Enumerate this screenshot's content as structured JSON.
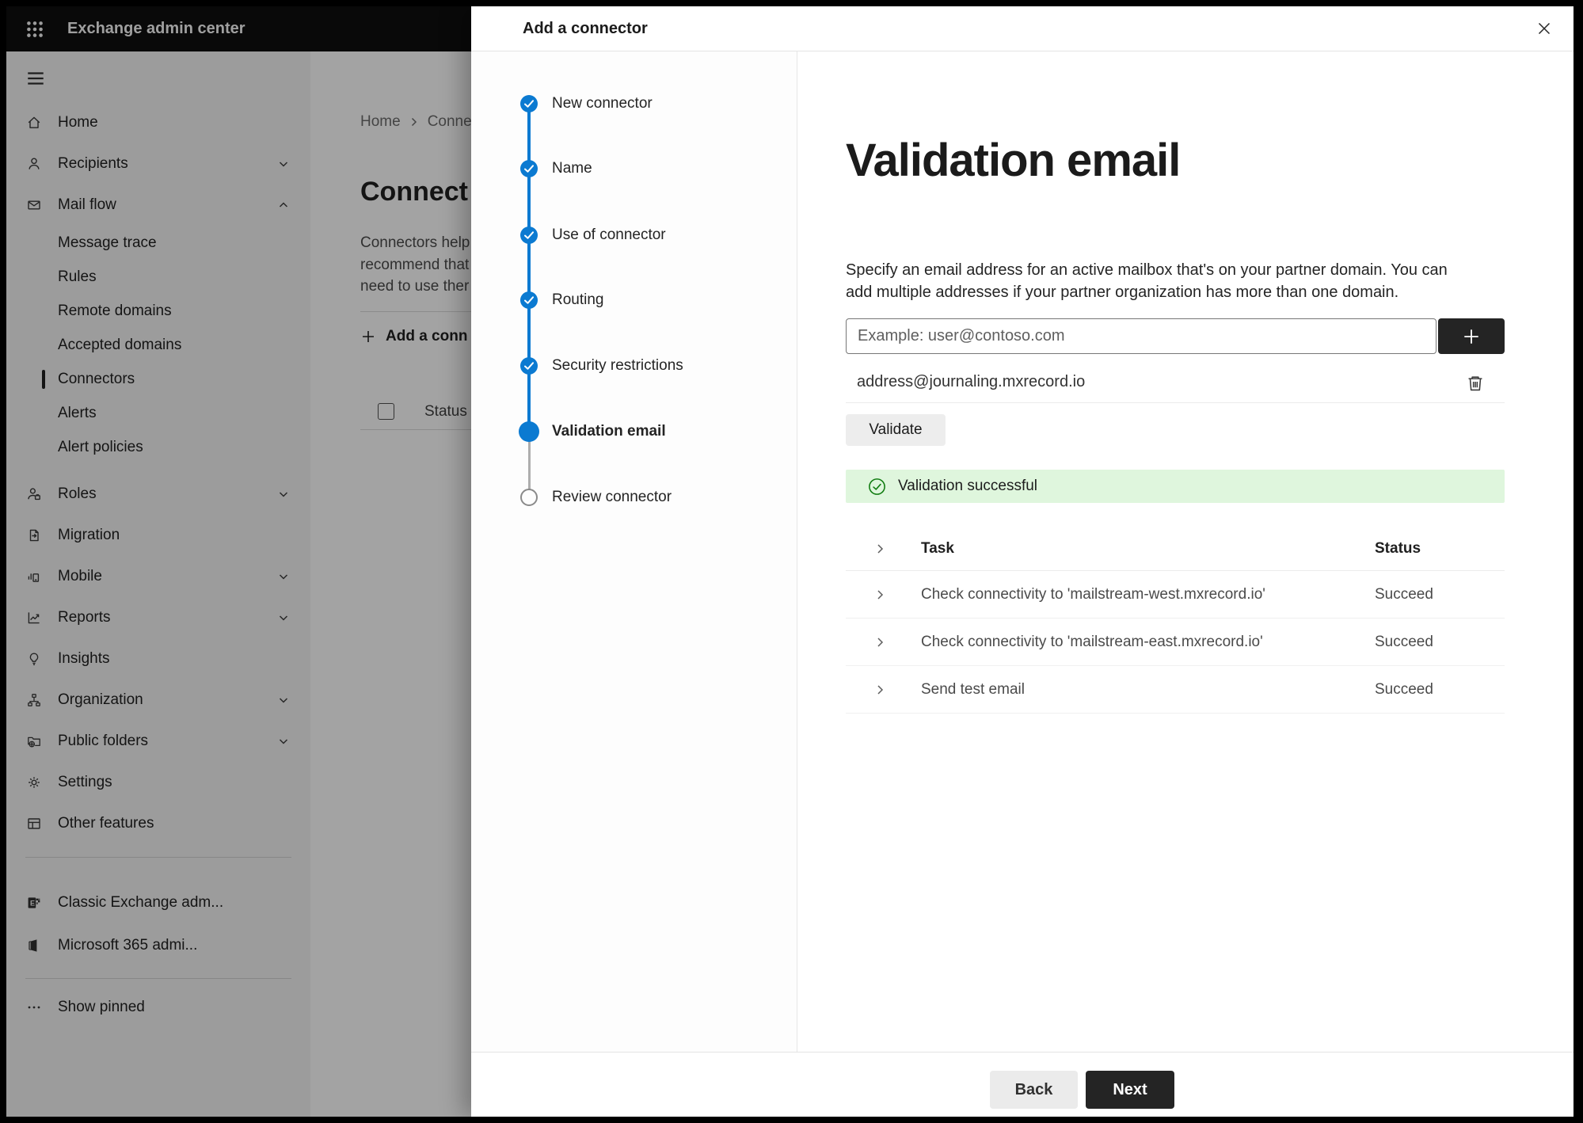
{
  "topbar": {
    "title": "Exchange admin center"
  },
  "sidebar": {
    "items": [
      {
        "label": "Home",
        "icon": "home-icon"
      },
      {
        "label": "Recipients",
        "icon": "person-icon",
        "chevron": "down"
      },
      {
        "label": "Mail flow",
        "icon": "mail-icon",
        "chevron": "up"
      },
      {
        "label": "Message trace",
        "type": "sub"
      },
      {
        "label": "Rules",
        "type": "sub"
      },
      {
        "label": "Remote domains",
        "type": "sub"
      },
      {
        "label": "Accepted domains",
        "type": "sub"
      },
      {
        "label": "Connectors",
        "type": "sub",
        "selected": true
      },
      {
        "label": "Alerts",
        "type": "sub"
      },
      {
        "label": "Alert policies",
        "type": "sub"
      },
      {
        "label": "Roles",
        "icon": "roles-icon",
        "chevron": "down"
      },
      {
        "label": "Migration",
        "icon": "migration-icon"
      },
      {
        "label": "Mobile",
        "icon": "mobile-icon",
        "chevron": "down"
      },
      {
        "label": "Reports",
        "icon": "reports-icon",
        "chevron": "down"
      },
      {
        "label": "Insights",
        "icon": "lightbulb-icon"
      },
      {
        "label": "Organization",
        "icon": "org-tree-icon",
        "chevron": "down"
      },
      {
        "label": "Public folders",
        "icon": "folder-globe-icon",
        "chevron": "down"
      },
      {
        "label": "Settings",
        "icon": "gear-icon"
      },
      {
        "label": "Other features",
        "icon": "table-icon"
      }
    ],
    "footer_items": [
      {
        "label": "Classic Exchange adm...",
        "icon": "exchange-logo-icon"
      },
      {
        "label": "Microsoft 365 admi...",
        "icon": "microsoft-365-icon"
      }
    ],
    "show_pinned": "Show pinned"
  },
  "background": {
    "breadcrumb": {
      "home": "Home",
      "current": "Conne"
    },
    "title": "Connect",
    "paragraph_lines": [
      "Connectors help",
      "recommend that",
      "need to use ther"
    ],
    "add_button": "Add a conn",
    "status_header": "Status"
  },
  "dialog": {
    "title": "Add a connector",
    "close_icon": "close-icon",
    "steps": [
      {
        "label": "New connector",
        "state": "done"
      },
      {
        "label": "Name",
        "state": "done"
      },
      {
        "label": "Use of connector",
        "state": "done"
      },
      {
        "label": "Routing",
        "state": "done"
      },
      {
        "label": "Security restrictions",
        "state": "done"
      },
      {
        "label": "Validation email",
        "state": "current"
      },
      {
        "label": "Review connector",
        "state": "todo"
      }
    ],
    "content": {
      "heading": "Validation email",
      "description": "Specify an email address for an active mailbox that's on your partner domain. You can add multiple addresses if your partner organization has more than one domain.",
      "input_placeholder": "Example: user@contoso.com",
      "add_address_icon": "plus-icon",
      "address": "address@journaling.mxrecord.io",
      "delete_icon": "trash-icon",
      "validate_label": "Validate",
      "banner": {
        "icon": "success-check-icon",
        "text": "Validation successful"
      },
      "table": {
        "headers": {
          "task": "Task",
          "status": "Status"
        },
        "rows": [
          {
            "task": "Check connectivity to 'mailstream-west.mxrecord.io'",
            "status": "Succeed"
          },
          {
            "task": "Check connectivity to 'mailstream-east.mxrecord.io'",
            "status": "Succeed"
          },
          {
            "task": "Send test email",
            "status": "Succeed"
          }
        ]
      }
    },
    "footer": {
      "back": "Back",
      "next": "Next"
    }
  },
  "colors": {
    "accent_blue": "#0b7ad1",
    "success_banner_bg": "#dff6dd",
    "success_green": "#107c10",
    "primary_button_dark": "#242424",
    "topbar_black": "#0e0e0e"
  }
}
